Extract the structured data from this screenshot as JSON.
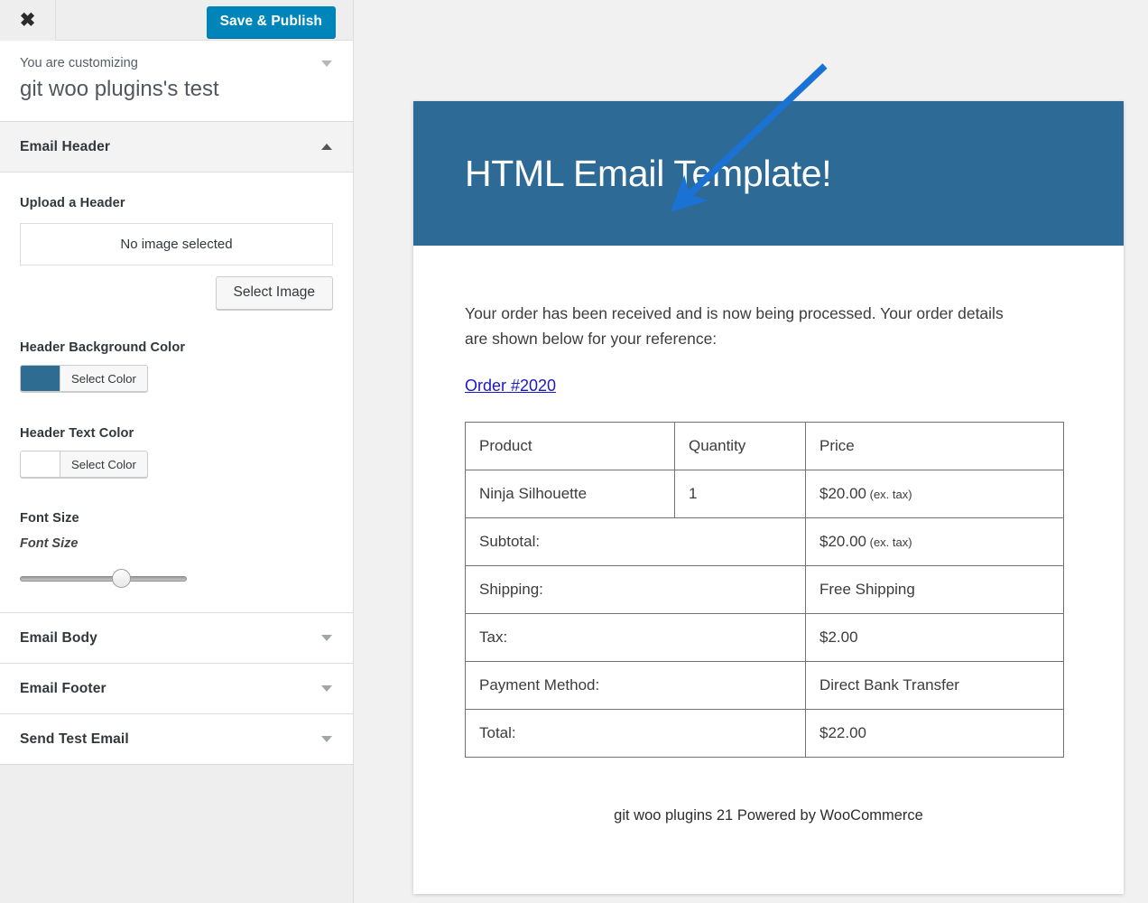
{
  "customizer": {
    "topbar": {
      "close_icon": "close-x-icon",
      "save_label": "Save & Publish",
      "save_color": "#0085ba"
    },
    "info_panel": {
      "customizing_label": "You are customizing",
      "site_title": "git woo plugins's test",
      "chevron_icon": "chevron-down-icon"
    },
    "sections": [
      {
        "title": "Email Header",
        "state": "open",
        "arrow_icon": "chevron-up-icon"
      },
      {
        "title": "Email Body",
        "state": "closed",
        "arrow_icon": "chevron-down-icon"
      },
      {
        "title": "Email Footer",
        "state": "closed",
        "arrow_icon": "chevron-down-icon"
      },
      {
        "title": "Send Test Email",
        "state": "closed",
        "arrow_icon": "chevron-down-icon"
      }
    ],
    "email_header_controls": {
      "upload_label": "Upload a Header",
      "image_placeholder_text": "No image selected",
      "select_image_label": "Select Image",
      "background_color": {
        "label": "Header Background Color",
        "button_label": "Select Color",
        "value": "#2e6c92"
      },
      "text_color": {
        "label": "Header Text Color",
        "button_label": "Select Color",
        "value": "#ffffff"
      },
      "font_size": {
        "label": "Font Size",
        "sublabel": "Font Size",
        "slider_percent": 62
      }
    }
  },
  "preview": {
    "banner": {
      "title": "HTML Email Template!",
      "background": "#2e6a96",
      "text_color": "#ffffff"
    },
    "intro_text": "Your order has been received and is now being processed. Your order details are shown below for your reference:",
    "order_link": "Order #2020",
    "table": {
      "headers": [
        "Product",
        "Quantity",
        "Price"
      ],
      "rows": [
        {
          "cells": [
            "Ninja Silhouette",
            "1",
            "$20.00"
          ],
          "note": "(ex. tax)",
          "span": false
        },
        {
          "cells": [
            "Subtotal:",
            "",
            "$20.00"
          ],
          "note": "(ex. tax)",
          "span": true
        },
        {
          "cells": [
            "Shipping:",
            "",
            "Free Shipping"
          ],
          "note": "",
          "span": true
        },
        {
          "cells": [
            "Tax:",
            "",
            "$2.00"
          ],
          "note": "",
          "span": true
        },
        {
          "cells": [
            "Payment Method:",
            "",
            "Direct Bank Transfer"
          ],
          "note": "",
          "span": true
        },
        {
          "cells": [
            "Total:",
            "",
            "$22.00"
          ],
          "note": "",
          "span": true
        }
      ]
    },
    "footer_text": "git woo plugins 21 Powered by WooCommerce"
  },
  "annotation": {
    "arrow_icon": "pointer-arrow-icon",
    "color": "#1a73d4"
  }
}
